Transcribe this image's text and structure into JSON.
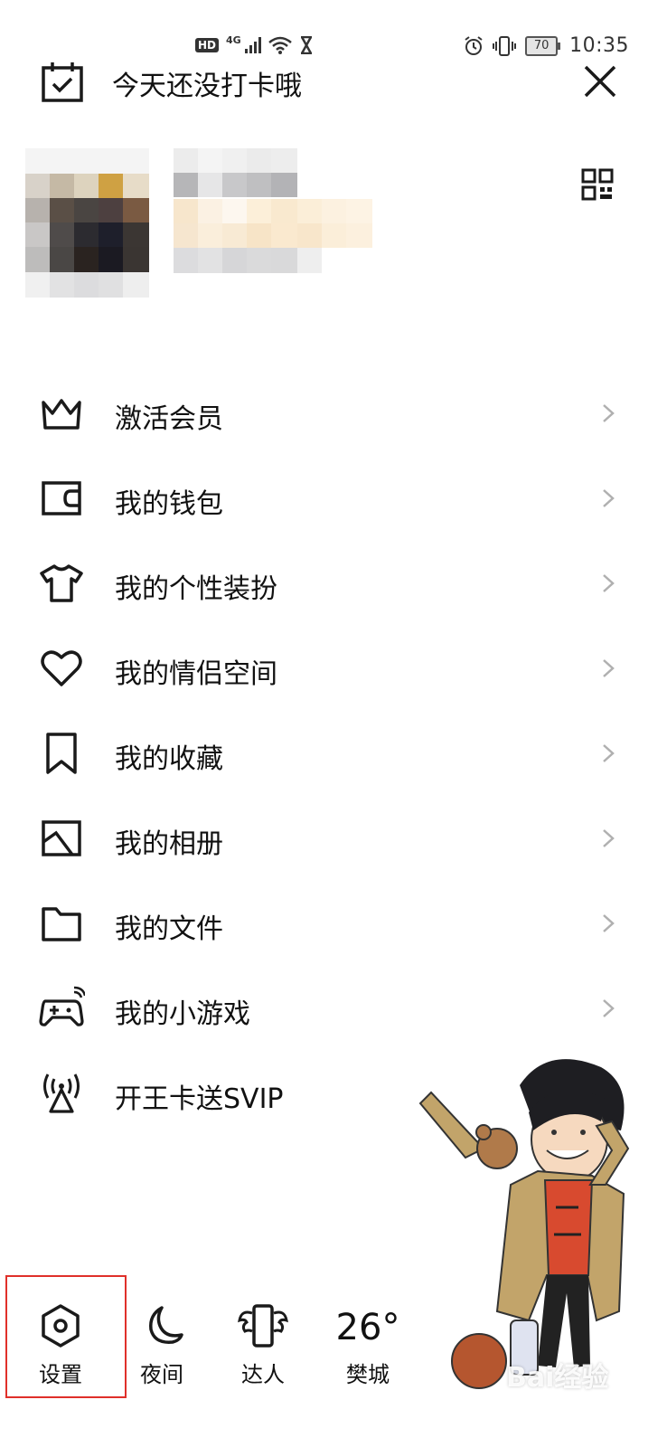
{
  "status_bar": {
    "hd_label": "HD",
    "network_label": "4G",
    "battery_level": "70",
    "time": "10:35"
  },
  "header": {
    "checkin_text": "今天还没打卡哦"
  },
  "menu": {
    "items": [
      {
        "label": "激活会员",
        "icon": "crown-icon",
        "has_arrow": true
      },
      {
        "label": "我的钱包",
        "icon": "wallet-icon",
        "has_arrow": true
      },
      {
        "label": "我的个性装扮",
        "icon": "tshirt-icon",
        "has_arrow": true
      },
      {
        "label": "我的情侣空间",
        "icon": "heart-icon",
        "has_arrow": true
      },
      {
        "label": "我的收藏",
        "icon": "bookmark-icon",
        "has_arrow": true
      },
      {
        "label": "我的相册",
        "icon": "photo-album-icon",
        "has_arrow": true
      },
      {
        "label": "我的文件",
        "icon": "folder-icon",
        "has_arrow": true
      },
      {
        "label": "我的小游戏",
        "icon": "gamepad-icon",
        "has_arrow": true
      },
      {
        "label": "开王卡送SVIP",
        "icon": "signal-tower-icon",
        "has_arrow": false
      }
    ]
  },
  "bottom_bar": {
    "settings_label": "设置",
    "night_label": "夜间",
    "expert_label": "达人",
    "weather_temp": "26°",
    "weather_city": "樊城"
  },
  "watermark": "Bai经验",
  "colors": {
    "highlight_frame": "#e0302a",
    "text": "#111111",
    "icon": "#1a1a1a",
    "arrow": "#b0b0b0"
  }
}
